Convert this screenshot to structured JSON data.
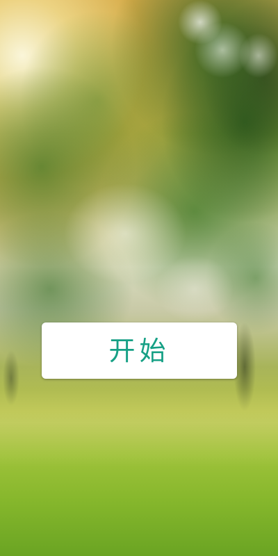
{
  "screen": {
    "background_scene": "blurred-nature-background",
    "start_button": {
      "label": "开始",
      "text_color": "#16a085",
      "background_color": "#ffffff"
    }
  }
}
